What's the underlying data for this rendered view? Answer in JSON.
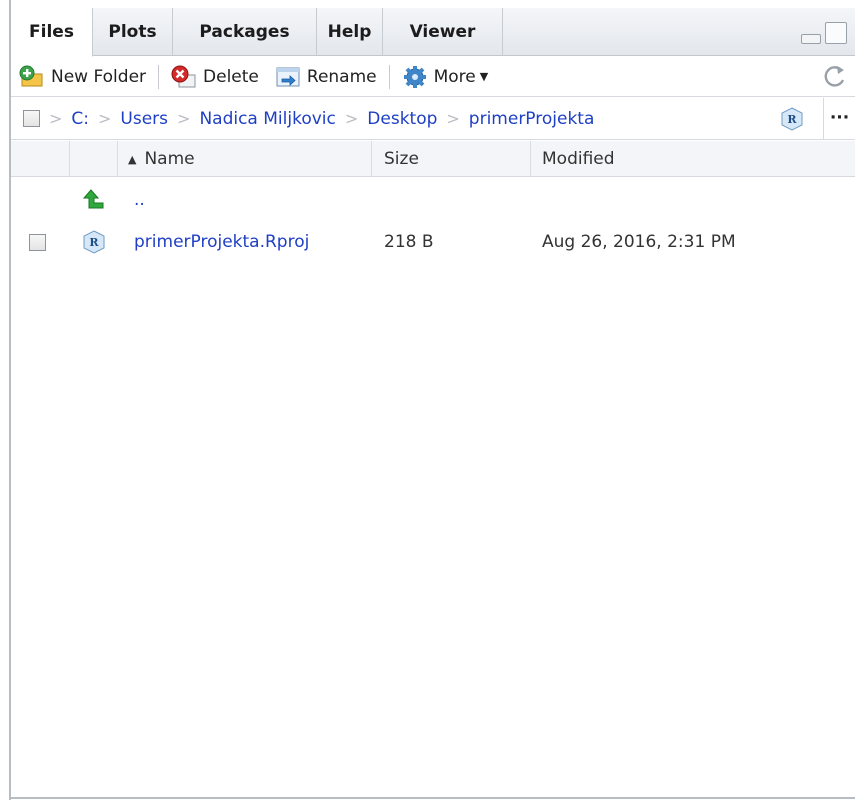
{
  "tabs": [
    {
      "label": "Files"
    },
    {
      "label": "Plots"
    },
    {
      "label": "Packages"
    },
    {
      "label": "Help"
    },
    {
      "label": "Viewer"
    }
  ],
  "toolbar": {
    "new_folder": "New Folder",
    "delete": "Delete",
    "rename": "Rename",
    "more": "More"
  },
  "breadcrumb": [
    "C:",
    "Users",
    "Nadica Miljkovic",
    "Desktop",
    "primerProjekta"
  ],
  "more_menu": "···",
  "columns": {
    "name": "Name",
    "size": "Size",
    "modified": "Modified",
    "sort_indicator": "▲"
  },
  "parent_dir": "..",
  "files": [
    {
      "name": "primerProjekta.Rproj",
      "size": "218 B",
      "modified": "Aug 26, 2016, 2:31 PM",
      "icon": "rproj-icon"
    }
  ],
  "colors": {
    "link": "#1f3fc4",
    "up_arrow": "#2eaa3c"
  }
}
